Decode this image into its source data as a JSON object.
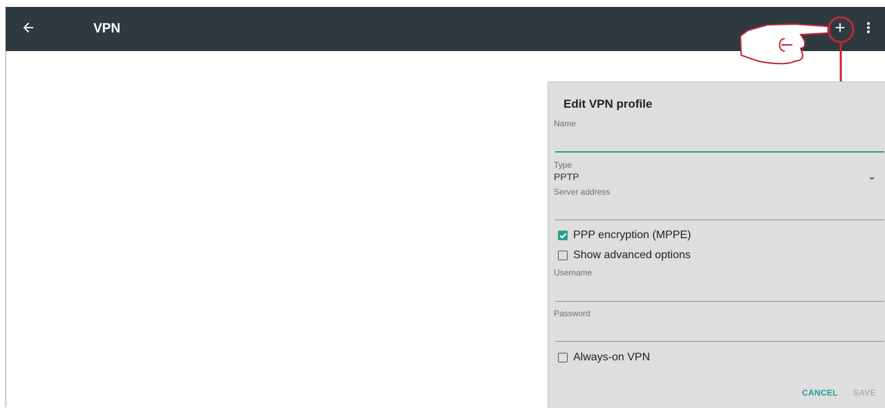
{
  "toolbar": {
    "title": "VPN",
    "back_icon": "arrow-left-icon",
    "add_icon": "plus-icon",
    "more_icon": "more-vert-icon"
  },
  "dialog": {
    "title": "Edit VPN profile",
    "name_label": "Name",
    "name_value": "",
    "type_label": "Type",
    "type_value": "PPTP",
    "server_label": "Server address",
    "server_value": "",
    "ppp_encryption": {
      "label": "PPP encryption (MPPE)",
      "checked": true
    },
    "show_advanced": {
      "label": "Show advanced options",
      "checked": false
    },
    "username_label": "Username",
    "username_value": "",
    "password_label": "Password",
    "password_value": "",
    "always_on": {
      "label": "Always-on VPN",
      "checked": false
    },
    "cancel_label": "CANCEL",
    "save_label": "SAVE"
  },
  "colors": {
    "toolbar_bg": "#2f3a40",
    "accent": "#279e8b",
    "annotation": "#c0283a",
    "dialog_bg": "#dedede",
    "disabled_text": "#b0b0b0"
  }
}
